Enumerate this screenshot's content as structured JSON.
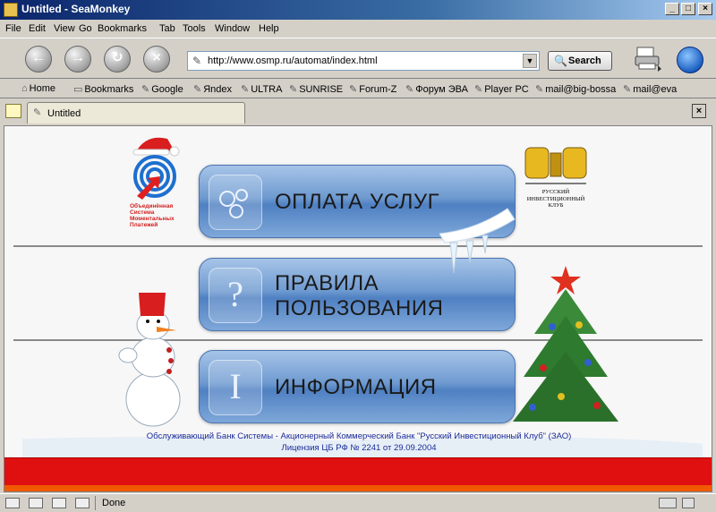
{
  "window": {
    "title": "Untitled - SeaMonkey"
  },
  "menu": [
    "File",
    "Edit",
    "View",
    "Go",
    "Bookmarks",
    "Tab",
    "Tools",
    "Window",
    "Help"
  ],
  "nav": {
    "url": "http://www.osmp.ru/automat/index.html",
    "search_label": "Search"
  },
  "bookmarks": [
    "Home",
    "Bookmarks",
    "Google",
    "Яndex",
    "ULTRA",
    "SUNRISE",
    "Forum-Z",
    "Форум ЭВА",
    "Player PC",
    "mail@big-bossa",
    "mail@eva"
  ],
  "tab": {
    "title": "Untitled"
  },
  "page": {
    "logo_left_text": "Объединённая Система Моментальных Платежей",
    "logo_right_text": "РУССКИЙ ИНВЕСТИЦИОННЫЙ КЛУБ",
    "buttons": [
      {
        "line1": "ОПЛАТА УСЛУГ",
        "line2": ""
      },
      {
        "line1": "ПРАВИЛА",
        "line2": "ПОЛЬЗОВАНИЯ"
      },
      {
        "line1": "ИНФОРМАЦИЯ",
        "line2": ""
      }
    ],
    "footer_line1": "Обслуживающий Банк Системы  - Акционерный Коммерческий Банк \"Русский Инвестиционный Клуб\" (ЗАО)",
    "footer_line2": "Лицензия ЦБ РФ № 2241 от 29.09.2004"
  },
  "status": {
    "text": "Done"
  }
}
